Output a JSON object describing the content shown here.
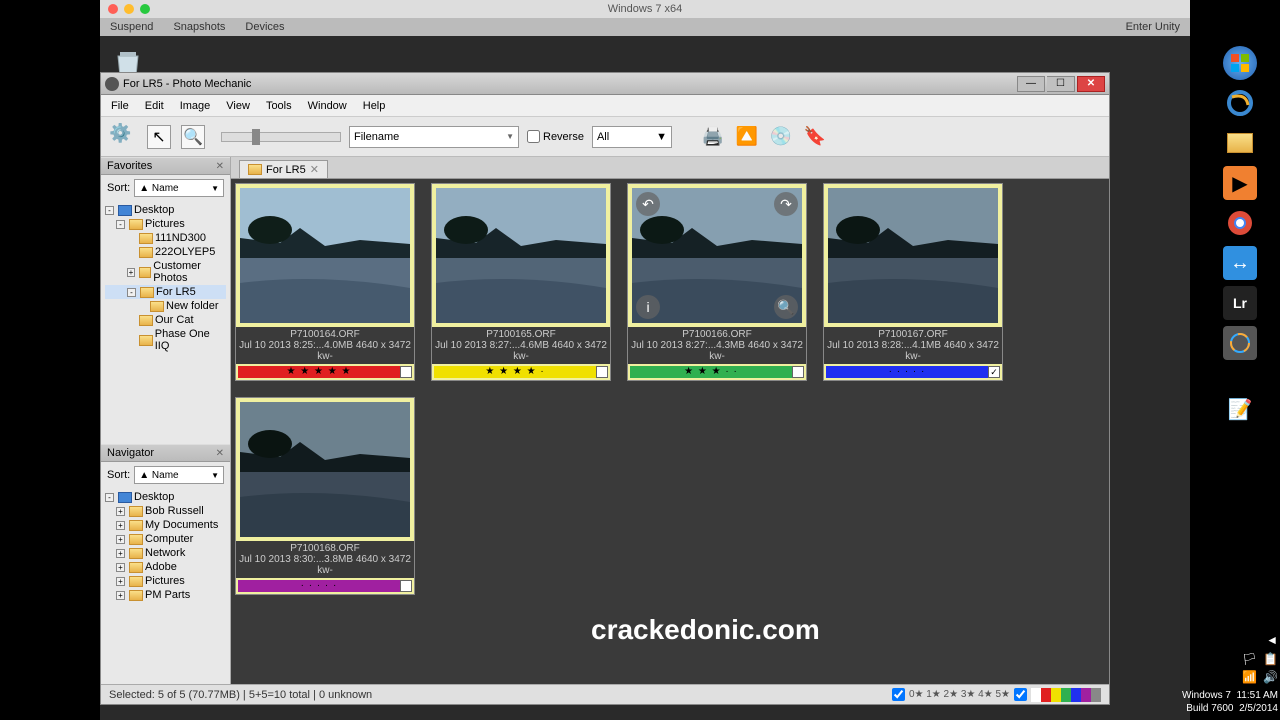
{
  "mac": {
    "title": "Windows 7 x64",
    "menu": [
      "Suspend",
      "Snapshots",
      "Devices"
    ],
    "menu_right": "Enter Unity"
  },
  "window": {
    "title": "For LR5 - Photo Mechanic"
  },
  "menubar": [
    "File",
    "Edit",
    "Image",
    "View",
    "Tools",
    "Window",
    "Help"
  ],
  "toolbar": {
    "filename_dropdown": "Filename",
    "reverse_label": "Reverse",
    "filter_dropdown": "All"
  },
  "sidebar": {
    "favorites_label": "Favorites",
    "navigator_label": "Navigator",
    "sort_label": "Sort:",
    "sort_value": "▲ Name",
    "fav_tree": {
      "desktop": "Desktop",
      "pictures": "Pictures",
      "items": [
        "111ND300",
        "222OLYEP5",
        "Customer Photos",
        "For LR5",
        "Our Cat",
        "Phase One IIQ"
      ],
      "new_folder": "New folder"
    },
    "nav_tree": {
      "desktop": "Desktop",
      "items": [
        "Bob Russell",
        "My Documents",
        "Computer",
        "Network",
        "Adobe",
        "Pictures",
        "PM Parts"
      ]
    }
  },
  "tabs": {
    "label": "For LR5"
  },
  "thumbs": [
    {
      "fname": "P7100164.ORF",
      "meta": "Jul 10 2013 8:25:...4.0MB 4640 x 3472",
      "sub": "kw-",
      "color": "#e02020",
      "stars": "★ ★ ★ ★ ★"
    },
    {
      "fname": "P7100165.ORF",
      "meta": "Jul 10 2013 8:27:...4.6MB 4640 x 3472",
      "sub": "kw-",
      "color": "#f0e000",
      "stars": "★ ★ ★ ★ ·"
    },
    {
      "fname": "P7100166.ORF",
      "meta": "Jul 10 2013 8:27:...4.3MB 4640 x 3472",
      "sub": "kw-",
      "color": "#30b050",
      "stars": "★ ★ ★ · ·"
    },
    {
      "fname": "P7100167.ORF",
      "meta": "Jul 10 2013 8:28:...4.1MB 4640 x 3472",
      "sub": "kw-",
      "color": "#2030f0",
      "stars": "· · · · ·"
    },
    {
      "fname": "P7100168.ORF",
      "meta": "Jul 10 2013 8:30:...3.8MB 4640 x 3472",
      "sub": "kw-",
      "color": "#a020a0",
      "stars": "· · · · ·"
    }
  ],
  "statusbar": {
    "text": "Selected: 5 of 5 (70.77MB) | 5+5=10 total | 0 unknown",
    "star_filters": "0★  1★  2★  3★  4★  5★"
  },
  "watermark": "crackedonic.com",
  "tray": {
    "os": "Windows 7",
    "build": "Build 7600",
    "time": "11:51 AM",
    "date": "2/5/2014"
  }
}
